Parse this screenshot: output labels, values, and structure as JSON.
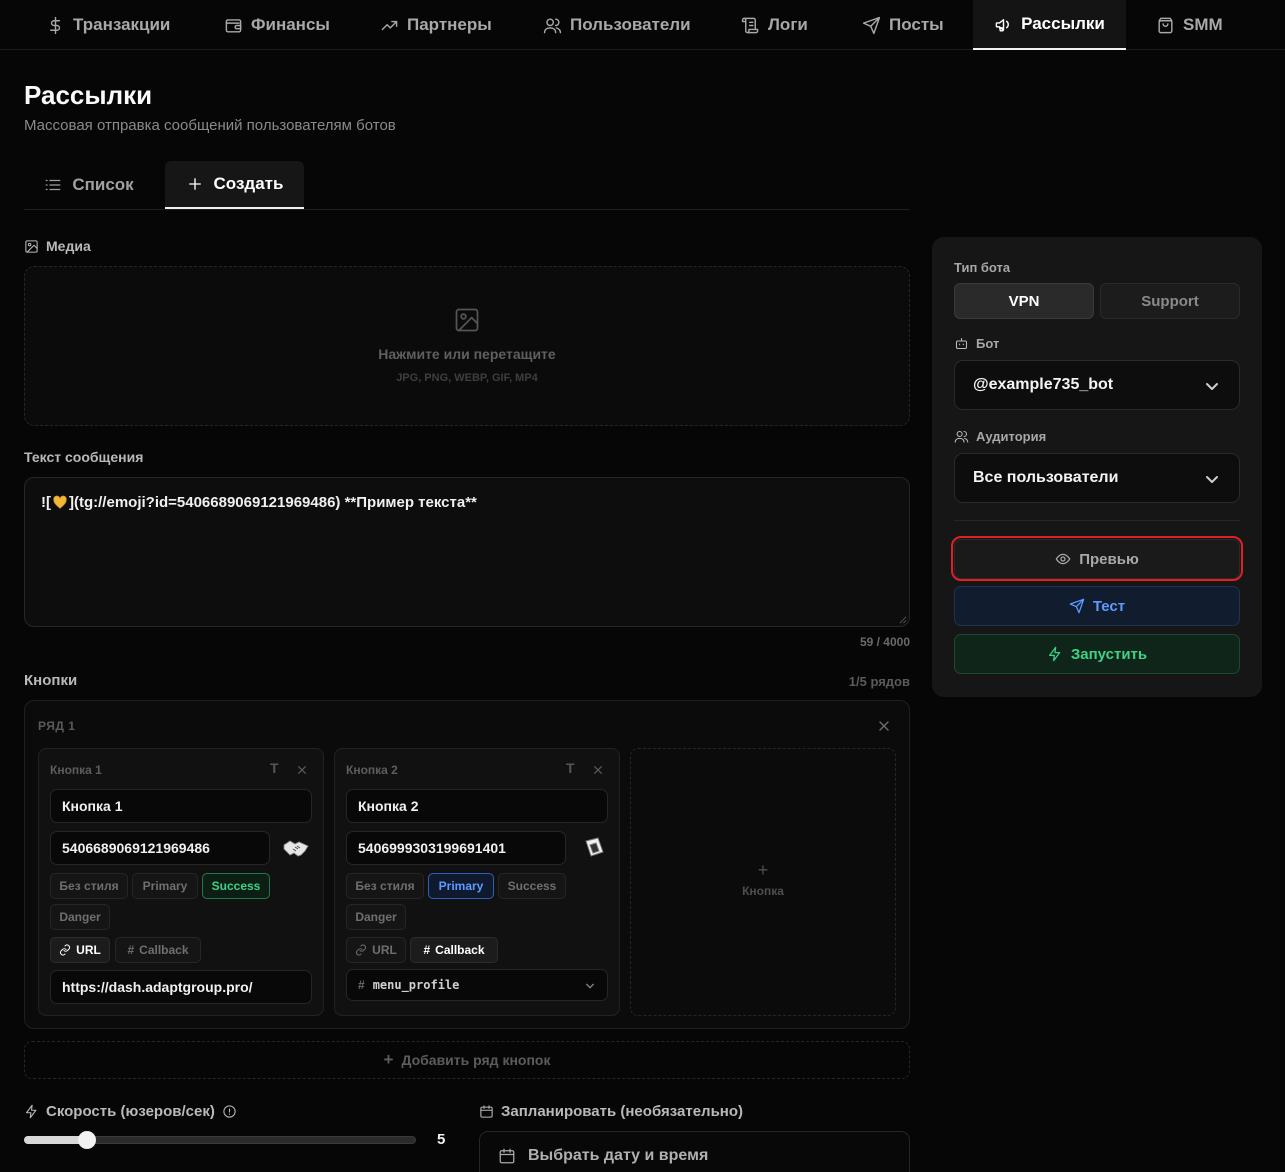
{
  "nav": {
    "tabs": [
      {
        "label": "Транзакции",
        "icon": "dollar-icon"
      },
      {
        "label": "Финансы",
        "icon": "wallet-icon"
      },
      {
        "label": "Партнеры",
        "icon": "trending-up-icon"
      },
      {
        "label": "Пользователи",
        "icon": "users-icon"
      },
      {
        "label": "Логи",
        "icon": "scroll-icon"
      },
      {
        "label": "Посты",
        "icon": "send-icon"
      },
      {
        "label": "Рассылки",
        "icon": "megaphone-icon"
      },
      {
        "label": "SMM",
        "icon": "shopping-bag-icon"
      }
    ],
    "active": "Рассылки"
  },
  "page": {
    "title": "Рассылки",
    "subtitle": "Массовая отправка сообщений пользователям ботов"
  },
  "subtabs": {
    "list": "Список",
    "create": "Создать",
    "active": "create"
  },
  "media": {
    "label": "Медиа",
    "drop_title": "Нажмите или перетащите",
    "drop_hint": "JPG, PNG, WEBP, GIF, MP4"
  },
  "message": {
    "label": "Текст сообщения",
    "prefix": "![",
    "suffix": "](tg://emoji?id=5406689069121969486) **Пример текста**",
    "counter": "59 / 4000"
  },
  "buttons": {
    "label": "Кнопки",
    "rows_counter": "1/5 рядов",
    "row_title": "РЯД 1",
    "add_button": "Кнопка",
    "add_row": "Добавить ряд кнопок",
    "style_options": [
      "Без стиля",
      "Primary",
      "Success",
      "Danger"
    ],
    "action_url": "URL",
    "action_callback": "Callback",
    "cards": [
      {
        "title": "Кнопка 1",
        "text": "Кнопка 1",
        "emoji_id": "5406689069121969486",
        "style": "Success",
        "action": "URL",
        "value": "https://dash.adaptgroup.pro/"
      },
      {
        "title": "Кнопка 2",
        "text": "Кнопка 2",
        "emoji_id": "5406999303199691401",
        "style": "Primary",
        "action": "Callback",
        "value": "menu_profile"
      }
    ]
  },
  "speed": {
    "label": "Скорость (юзеров/сек)",
    "value": "5",
    "fraction": 0.16
  },
  "schedule": {
    "label": "Запланировать (необязательно)",
    "placeholder": "Выбрать дату и время"
  },
  "panel": {
    "bot_type_label": "Тип бота",
    "bot_types": [
      "VPN",
      "Support"
    ],
    "bot_type_selected": "VPN",
    "bot_label": "Бот",
    "bot_value": "@example735_bot",
    "audience_label": "Аудитория",
    "audience_value": "Все пользователи",
    "preview": "Превью",
    "test": "Тест",
    "launch": "Запустить"
  },
  "colors": {
    "success": "#3fd186",
    "primary": "#5d9bff",
    "highlight": "#e01f26"
  }
}
